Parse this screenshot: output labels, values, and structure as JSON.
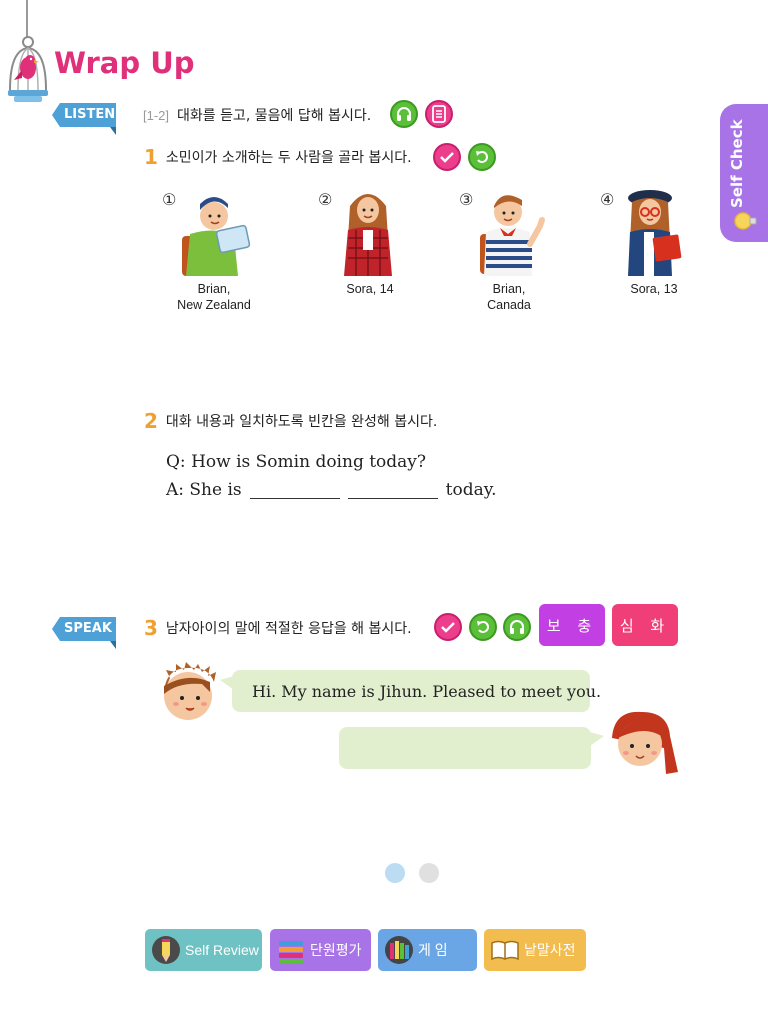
{
  "header": {
    "title": "Wrap Up"
  },
  "side_tab": {
    "label": "Self Check"
  },
  "listen": {
    "tag": "LISTEN",
    "range": "[1-2]",
    "instruction": "대화를 듣고, 물음에 답해 봅시다."
  },
  "q1": {
    "number": "1",
    "instruction": "소민이가 소개하는 두 사람을 골라 봅시다.",
    "people": [
      {
        "num": "①",
        "caption_line1": "Brian,",
        "caption_line2": "New Zealand"
      },
      {
        "num": "②",
        "caption_line1": "Sora, 14",
        "caption_line2": ""
      },
      {
        "num": "③",
        "caption_line1": "Brian,",
        "caption_line2": "Canada"
      },
      {
        "num": "④",
        "caption_line1": "Sora, 13",
        "caption_line2": ""
      }
    ]
  },
  "q2": {
    "number": "2",
    "instruction": "대화 내용과 일치하도록 빈칸을 완성해 봅시다.",
    "question": "Q: How is Somin doing today?",
    "answer_start": "A: She is",
    "answer_end": "today."
  },
  "speak": {
    "tag": "SPEAK",
    "number": "3",
    "instruction": "남자아이의 말에 적절한 응답을 해 봅시다.",
    "btn_supplement": "보 충",
    "btn_advanced": "심 화",
    "boy_line": "Hi. My name is Jihun. Pleased to meet you.",
    "girl_line": ""
  },
  "bottom_bar": {
    "self_review": "Self Review",
    "unit_test": "단원평가",
    "game": "게    임",
    "dictionary": "낱말사전"
  },
  "colors": {
    "title": "#e0307a",
    "ribbon": "#4da1d6",
    "self_check": "#a873e6",
    "supplement": "#c23fe3",
    "advanced": "#f03e78",
    "bubble": "#e2efcf"
  }
}
